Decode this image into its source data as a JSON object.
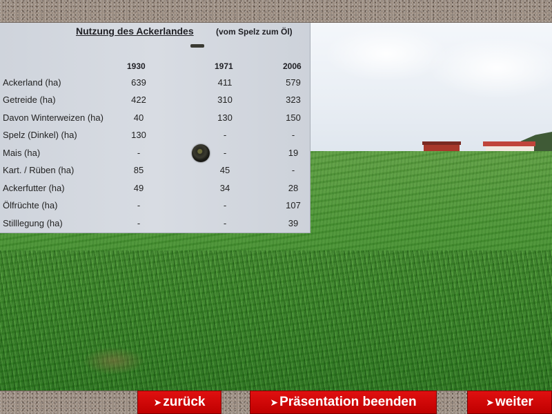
{
  "board": {
    "title": "Nutzung des Ackerlandes",
    "subtitle": "(vom Spelz zum Öl)",
    "years": [
      "1930",
      "1971",
      "2006"
    ],
    "rows": [
      {
        "label": "Ackerland (ha)",
        "values": [
          "639",
          "411",
          "579"
        ]
      },
      {
        "label": "Getreide   (ha)",
        "values": [
          "422",
          "310",
          "323"
        ]
      },
      {
        "label": "Davon Winterweizen (ha)",
        "values": [
          "40",
          "130",
          "150"
        ]
      },
      {
        "label": "Spelz (Dinkel) (ha)",
        "values": [
          "130",
          "-",
          "-"
        ]
      },
      {
        "label": "Mais (ha)",
        "values": [
          "-",
          "-",
          "19"
        ]
      },
      {
        "label": "Kart. / Rüben (ha)",
        "values": [
          "85",
          "45",
          "-"
        ]
      },
      {
        "label": "Ackerfutter (ha)",
        "values": [
          "49",
          "34",
          "28"
        ]
      },
      {
        "label": "Ölfrüchte (ha)",
        "values": [
          "-",
          "-",
          "107"
        ]
      },
      {
        "label": "Stilllegung (ha)",
        "values": [
          "-",
          "-",
          "39"
        ]
      }
    ]
  },
  "nav": {
    "arrow_glyph": "➤",
    "back_label": "zurück",
    "end_label": "Präsentation beenden",
    "next_label": "weiter"
  },
  "colors": {
    "button_red": "#d00000",
    "button_text": "#ffffff",
    "board_bg": "#d4d8df",
    "field_green": "#4c9435"
  }
}
